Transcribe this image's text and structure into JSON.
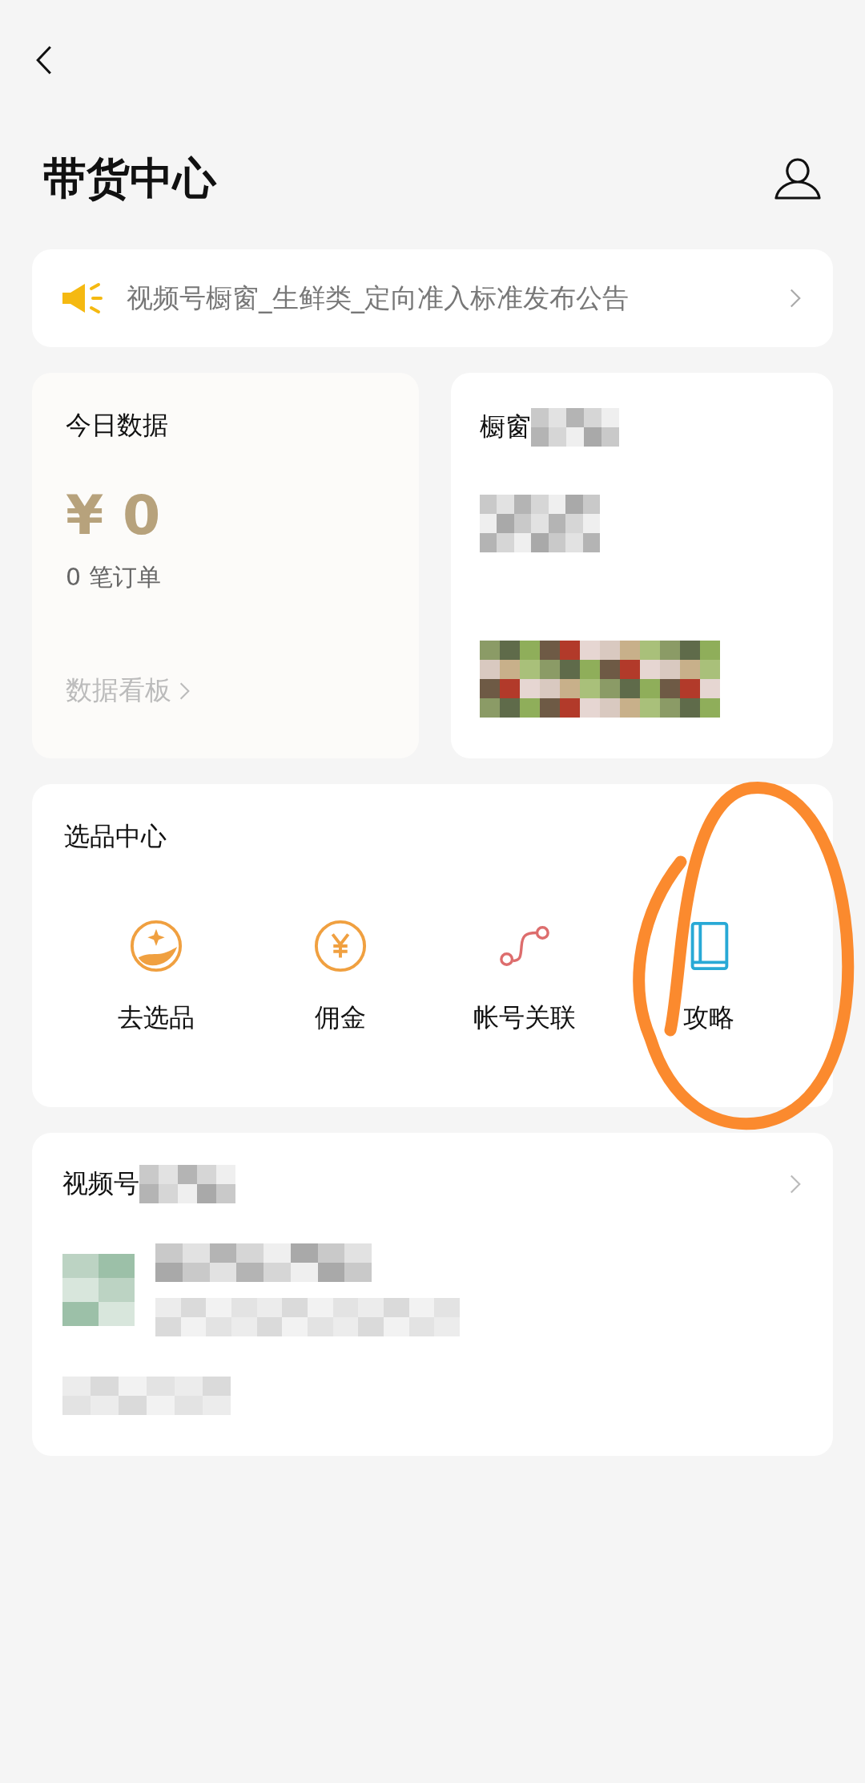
{
  "header": {
    "title": "带货中心"
  },
  "notice": {
    "text": "视频号橱窗_生鲜类_定向准入标准发布公告"
  },
  "today": {
    "title": "今日数据",
    "amount": "¥ 0",
    "orders": "0 笔订单",
    "link": "数据看板"
  },
  "showcase": {
    "title": "橱窗"
  },
  "selection": {
    "title": "选品中心",
    "items": [
      {
        "kind": "pick",
        "label": "去选品"
      },
      {
        "kind": "commission",
        "label": "佣金"
      },
      {
        "kind": "link",
        "label": "帐号关联"
      },
      {
        "kind": "guide",
        "label": "攻略"
      }
    ]
  },
  "shop": {
    "title": "视频号"
  }
}
